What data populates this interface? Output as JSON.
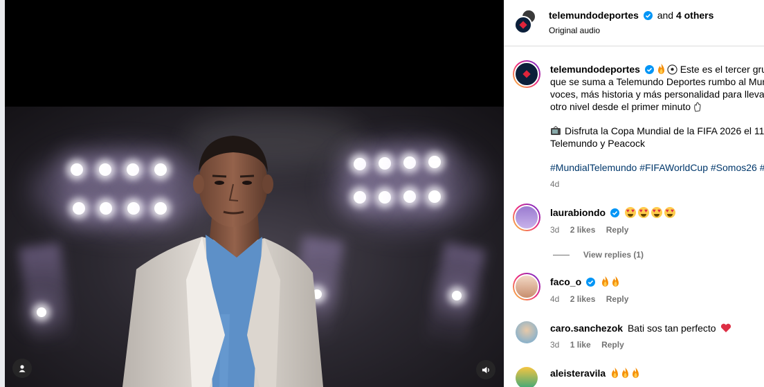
{
  "post": {
    "author": "telemundodeportes",
    "and_text": "and",
    "others": "4 others",
    "audio": "Original audio"
  },
  "caption": {
    "author": "telemundodeportes",
    "line1": "Este es el tercer grup",
    "line2": "que se suma a Telemundo Deportes rumbo al Mun",
    "line3": "voces, más historia y más personalidad para llevar",
    "line4": "otro nivel desde el primer minuto",
    "line5": "Disfruta la Copa Mundial de la FIFA 2026 el 11",
    "line6": "Telemundo y Peacock",
    "hashtags": "#MundialTelemundo #FIFAWorldCup #Somos26 #",
    "time": "4d"
  },
  "comments": [
    {
      "user": "laurabiondo",
      "time": "3d",
      "likes": "2 likes",
      "reply": "Reply"
    },
    {
      "user": "faco_o",
      "time": "4d",
      "likes": "2 likes",
      "reply": "Reply"
    },
    {
      "user": "caro.sanchezok",
      "text": "Bati sos tan perfecto",
      "time": "3d",
      "likes": "1 like",
      "reply": "Reply"
    },
    {
      "user": "aleisteravila"
    }
  ],
  "view_replies": "View replies (1)",
  "colors": {
    "link": "#00376b",
    "verified": "#0095f6",
    "muted": "#737373"
  },
  "icons": [
    "user-tag-icon",
    "volume-icon",
    "verified-icon",
    "fire-emoji-icon",
    "soccer-ball-emoji-icon",
    "heart-eyes-emoji-icon",
    "tv-emoji-icon",
    "heart-emoji-icon"
  ]
}
